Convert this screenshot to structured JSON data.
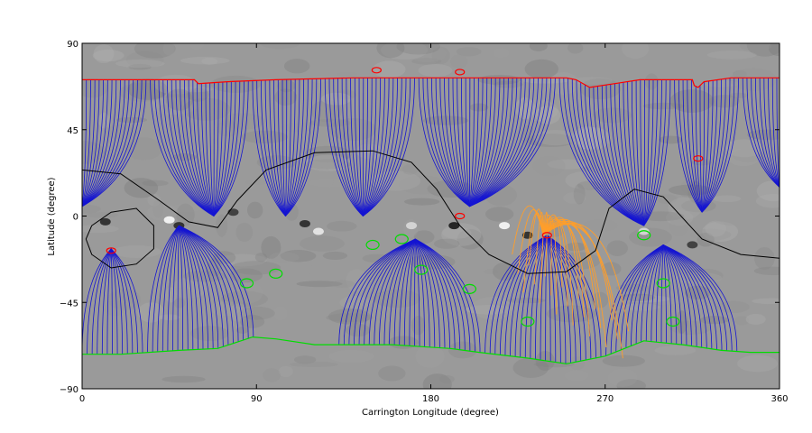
{
  "chart_data": {
    "type": "scatter",
    "title": "",
    "xlabel": "Carrington Longitude (degree)",
    "ylabel": "Latitude (degree)",
    "xlim": [
      0,
      360
    ],
    "ylim": [
      -90,
      90
    ],
    "xticks": [
      0,
      90,
      180,
      270,
      360
    ],
    "xtick_labels": [
      "0",
      "90",
      "180",
      "270",
      "360"
    ],
    "yticks": [
      -90,
      -45,
      0,
      45,
      90
    ],
    "ytick_labels": [
      "−90",
      "−45",
      "0",
      "45",
      "90"
    ],
    "grid": false,
    "legend": "none",
    "background": "grayscale magnetogram",
    "colors": {
      "open_field_lines": "#1414d2",
      "flux_rope_lines": "#ff9e2a",
      "positive_boundary": "#ff0000",
      "negative_boundary": "#00dd00",
      "neutral_line": "#000000"
    },
    "series": [
      {
        "points": [
          [
            0,
            71
          ],
          [
            40,
            71
          ],
          [
            58,
            71
          ],
          [
            60,
            69
          ],
          [
            75,
            70
          ],
          [
            100,
            71
          ],
          [
            140,
            72
          ],
          [
            180,
            72
          ],
          [
            250,
            72
          ],
          [
            255,
            71
          ],
          [
            262,
            67
          ],
          [
            275,
            69
          ],
          [
            288,
            71
          ],
          [
            315,
            71
          ],
          [
            316,
            68
          ],
          [
            318,
            67
          ],
          [
            321,
            70
          ],
          [
            335,
            72
          ],
          [
            360,
            72
          ]
        ]
      },
      {
        "points": [
          [
            0,
            -72
          ],
          [
            20,
            -72
          ],
          [
            50,
            -70
          ],
          [
            70,
            -69
          ],
          [
            88,
            -63
          ],
          [
            100,
            -64
          ],
          [
            120,
            -67
          ],
          [
            160,
            -67
          ],
          [
            190,
            -69
          ],
          [
            205,
            -71
          ],
          [
            230,
            -74
          ],
          [
            250,
            -77
          ],
          [
            270,
            -73
          ],
          [
            290,
            -65
          ],
          [
            310,
            -67
          ],
          [
            330,
            -70
          ],
          [
            345,
            -71
          ],
          [
            360,
            -71
          ]
        ]
      },
      {
        "points": [
          [
            0,
            24
          ],
          [
            20,
            22
          ],
          [
            40,
            8
          ],
          [
            55,
            -3
          ],
          [
            70,
            -6
          ],
          [
            80,
            8
          ],
          [
            95,
            24
          ],
          [
            120,
            33
          ],
          [
            150,
            34
          ],
          [
            170,
            28
          ],
          [
            183,
            14
          ],
          [
            195,
            -5
          ],
          [
            210,
            -20
          ],
          [
            230,
            -30
          ],
          [
            250,
            -29
          ],
          [
            265,
            -18
          ],
          [
            272,
            4
          ],
          [
            285,
            14
          ],
          [
            300,
            10
          ],
          [
            320,
            -12
          ],
          [
            340,
            -20
          ],
          [
            360,
            -22
          ]
        ]
      },
      {
        "points": [
          [
            5,
            -5
          ],
          [
            15,
            2
          ],
          [
            28,
            4
          ],
          [
            37,
            -5
          ],
          [
            37,
            -17
          ],
          [
            28,
            -25
          ],
          [
            15,
            -27
          ],
          [
            5,
            -20
          ],
          [
            2,
            -12
          ],
          [
            5,
            -5
          ]
        ]
      }
    ]
  }
}
